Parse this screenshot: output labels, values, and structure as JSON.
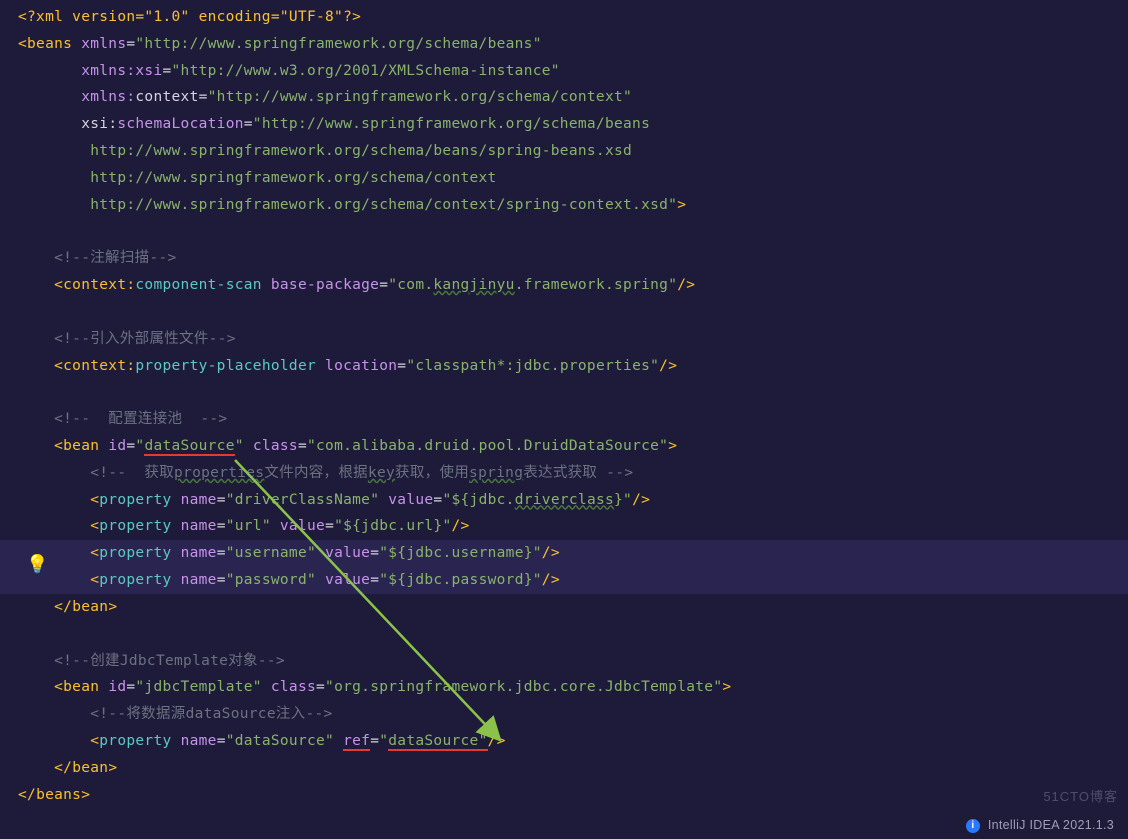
{
  "code": {
    "l1": {
      "decl": "<?xml version=\"1.0\" encoding=\"UTF-8\"?>"
    },
    "l2": {
      "open": "<",
      "tag": "beans",
      "sp": " ",
      "a1": "xmlns",
      "eq": "=",
      "v1": "\"http://www.springframework.org/schema/beans\""
    },
    "l3": {
      "a": "xmlns:xsi",
      "eq": "=",
      "v": "\"http://www.w3.org/2001/XMLSchema-instance\""
    },
    "l4": {
      "a": "xmlns:",
      "ca": "context",
      "eq": "=",
      "v": "\"http://www.springframework.org/schema/context\""
    },
    "l5": {
      "xsi": "xsi",
      "colon": ":",
      "a": "schemaLocation",
      "eq": "=",
      "v": "\"http://www.springframework.org/schema/beans"
    },
    "l6": {
      "v": "http://www.springframework.org/schema/beans/spring-beans.xsd"
    },
    "l7": {
      "v": "http://www.springframework.org/schema/context"
    },
    "l8": {
      "v": "http://www.springframework.org/schema/context/spring-context.xsd\"",
      "close": ">"
    },
    "c1": "<!--注解扫描-->",
    "l9": {
      "open": "<",
      "ns": "context",
      "colon": ":",
      "tag": "component-scan",
      "sp": " ",
      "a": "base-package",
      "eq": "=",
      "vq": "\"",
      "v1": "com.",
      "vu": "kangjinyu",
      "v2": ".framework.spring",
      "vq2": "\"",
      "close": "/>"
    },
    "c2": "<!--引入外部属性文件-->",
    "l10": {
      "open": "<",
      "ns": "context",
      "colon": ":",
      "tag": "property-placeholder",
      "sp": " ",
      "a": "location",
      "eq": "=",
      "v": "\"classpath*:jdbc.properties\"",
      "close": "/>"
    },
    "c3": "<!--  配置连接池  -->",
    "l11": {
      "open": "<",
      "tag": "bean",
      "sp": " ",
      "a1": "id",
      "eq": "=",
      "v1q": "\"",
      "v1": "dataSource",
      "v1q2": "\"",
      "sp2": " ",
      "a2": "class",
      "eq2": "=",
      "v2": "\"com.alibaba.druid.pool.DruidDataSource\"",
      "close": ">"
    },
    "c4": {
      "pre": "<!--  获取",
      "pu": "properties",
      "mid": "文件内容，根据",
      "ku": "key",
      "mid2": "获取，使用",
      "su": "spring",
      "post": "表达式获取 -->"
    },
    "p1": {
      "open": "<",
      "tag": "property",
      "sp": " ",
      "a1": "name",
      "eq": "=",
      "v1": "\"driverClassName\"",
      "sp2": " ",
      "a2": "value",
      "eq2": "=",
      "v2a": "\"${jdbc.",
      "v2u": "driverclass",
      "v2b": "}\"",
      "close": "/>"
    },
    "p2": {
      "open": "<",
      "tag": "property",
      "sp": " ",
      "a1": "name",
      "eq": "=",
      "v1": "\"url\"",
      "sp2": " ",
      "a2": "value",
      "eq2": "=",
      "v2": "\"${jdbc.url}\"",
      "close": "/>"
    },
    "p3": {
      "open": "<",
      "tag": "property",
      "sp": " ",
      "a1": "name",
      "eq": "=",
      "v1": "\"username\"",
      "sp2": " ",
      "a2": "value",
      "eq2": "=",
      "v2": "\"${jdbc.username}\"",
      "close": "/>"
    },
    "p4": {
      "open": "<",
      "tag": "property",
      "sp": " ",
      "a1": "name",
      "eq": "=",
      "v1": "\"password\"",
      "sp2": " ",
      "a2": "value",
      "eq2": "=",
      "v2": "\"${jdbc.password}\"",
      "close": "/>"
    },
    "l12": {
      "open": "</",
      "tag": "bean",
      "close": ">"
    },
    "c5": "<!--创建JdbcTemplate对象-->",
    "l13": {
      "open": "<",
      "tag": "bean",
      "sp": " ",
      "a1": "id",
      "eq": "=",
      "v1": "\"jdbcTemplate\"",
      "sp2": " ",
      "a2": "class",
      "eq2": "=",
      "v2": "\"org.springframework.jdbc.core.JdbcTemplate\"",
      "close": ">"
    },
    "c6": "<!--将数据源dataSource注入-->",
    "p5": {
      "open": "<",
      "tag": "property",
      "sp": " ",
      "a1": "name",
      "eq": "=",
      "v1": "\"dataSource\"",
      "sp2": " ",
      "a2": "ref",
      "eq2": "=",
      "v2q": "\"",
      "v2": "dataSource",
      "v2q2": "\"",
      "close": "/>"
    },
    "l14": {
      "open": "</",
      "tag": "bean",
      "close": ">"
    },
    "l15": {
      "open": "</",
      "tag": "beans",
      "close": ">"
    }
  },
  "status": {
    "label": "IntelliJ IDEA 2021.1.3"
  },
  "watermark": "51CTO博客"
}
